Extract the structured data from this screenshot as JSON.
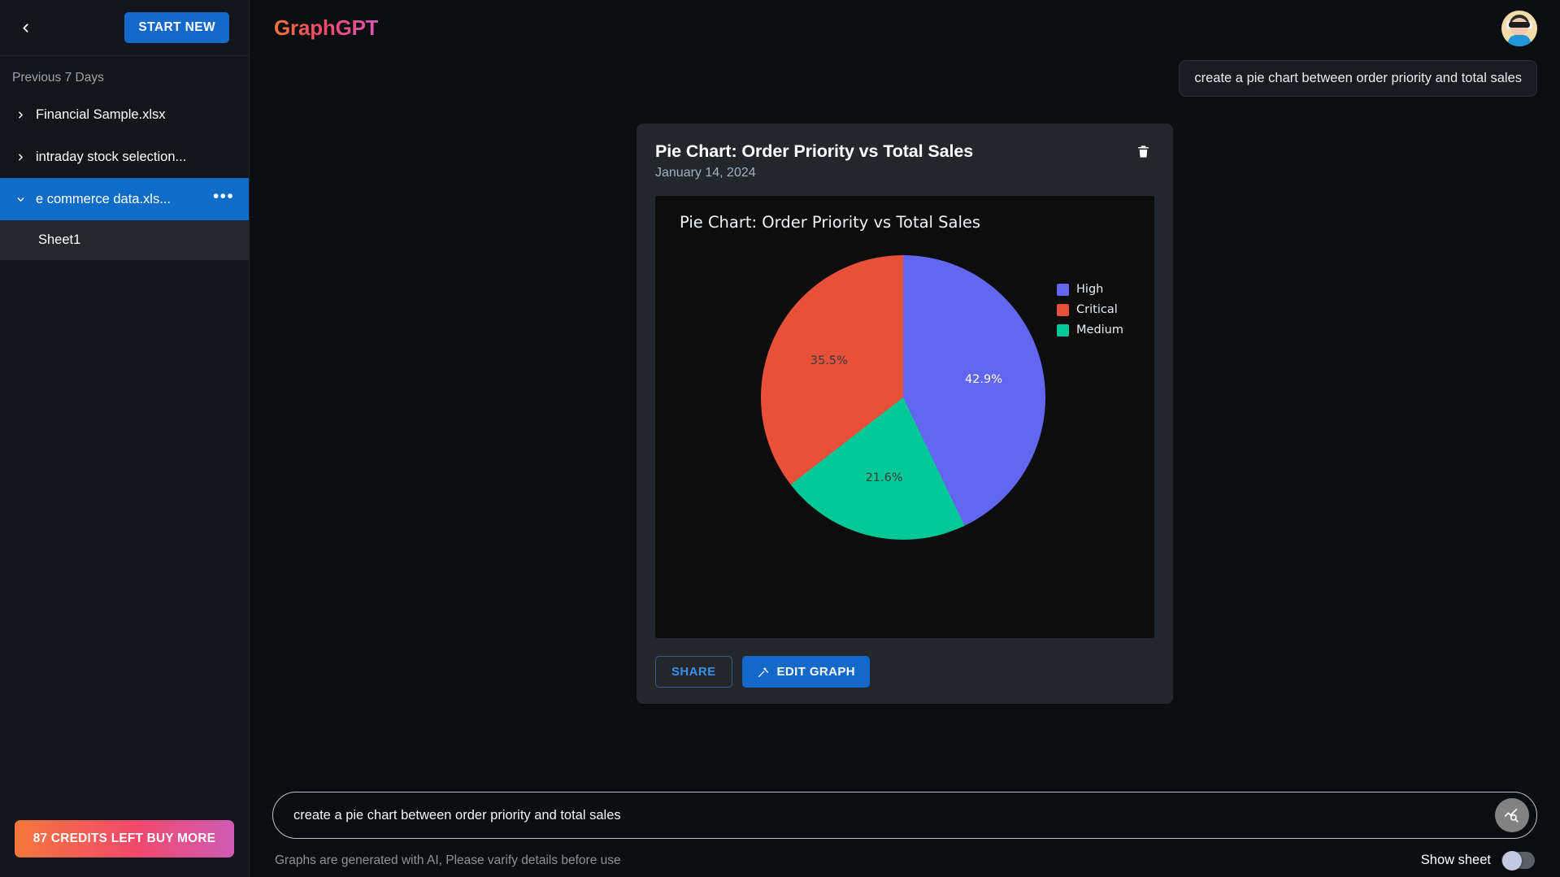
{
  "sidebar": {
    "collapse_icon": "chevron-left-icon",
    "start_new_label": "START NEW",
    "section_label": "Previous 7 Days",
    "items": [
      {
        "label": "Financial Sample.xlsx",
        "icon": "chevron-right-icon",
        "selected": false
      },
      {
        "label": "intraday stock selection...",
        "icon": "chevron-right-icon",
        "selected": false
      },
      {
        "label": "e commerce data.xls...",
        "icon": "chevron-down-icon",
        "selected": true,
        "menu_icon": "ellipsis-icon"
      }
    ],
    "child_item": "Sheet1",
    "credits_label": "87 CREDITS LEFT BUY MORE"
  },
  "header": {
    "brand": "GraphGPT",
    "avatar_icon": "user-avatar"
  },
  "conversation": {
    "user_message": "create a pie chart between order priority and total sales"
  },
  "card": {
    "title": "Pie Chart: Order Priority vs Total Sales",
    "date": "January 14, 2024",
    "delete_icon": "trash-icon",
    "share_label": "SHARE",
    "edit_label": "EDIT GRAPH",
    "edit_icon": "magic-wand-icon"
  },
  "composer": {
    "value": "create a pie chart between order priority and total sales",
    "placeholder": "create a pie chart between order priority and total sales",
    "send_icon": "analyze-chart-icon",
    "disclaimer": "Graphs are generated with AI, Please varify details before use",
    "sheet_toggle_label": "Show sheet",
    "sheet_toggle_state": "off"
  },
  "colors": {
    "accent_blue": "#1269c9",
    "high": "#6366f1",
    "critical": "#e8503a",
    "medium": "#00c896",
    "card_bg": "#23272c",
    "plot_bg": "#0d0d0d"
  },
  "chart_data": {
    "type": "pie",
    "title": "Pie Chart: Order Priority vs Total Sales",
    "categories": [
      "High",
      "Critical",
      "Medium"
    ],
    "values": [
      42.9,
      35.5,
      21.6
    ],
    "labels": [
      "42.9%",
      "35.5%",
      "21.6%"
    ],
    "colors": [
      "#6366f1",
      "#e8503a",
      "#00c896"
    ],
    "legend": [
      "High",
      "Critical",
      "Medium"
    ],
    "legend_position": "right",
    "start_angle": 0,
    "direction": "clockwise",
    "label_colors": [
      "#ffffff",
      "#3a3a3a",
      "#3a3a3a"
    ],
    "xlabel": "",
    "ylabel": ""
  }
}
